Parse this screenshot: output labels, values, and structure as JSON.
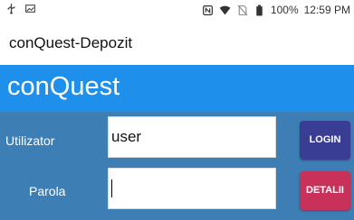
{
  "statusbar": {
    "battery_percent": "100%",
    "time": "12:59 PM",
    "icons_left": [
      "usb-icon",
      "gallery-icon"
    ],
    "icons_right": [
      "nfc-icon",
      "wifi-icon",
      "no-sim-icon",
      "battery-icon"
    ]
  },
  "appbar": {
    "title": "conQuest-Depozit"
  },
  "brand": {
    "title": "conQuest"
  },
  "form": {
    "username_label": "Utilizator",
    "username_value": "user",
    "password_label": "Parola",
    "password_value": ""
  },
  "buttons": {
    "login_label": "LOGIN",
    "details_label": "DETALII"
  },
  "colors": {
    "brand_bar": "#1e90ec",
    "panel": "#3d7fb4",
    "login_button": "#3a3d94",
    "details_button": "#c8325a"
  }
}
